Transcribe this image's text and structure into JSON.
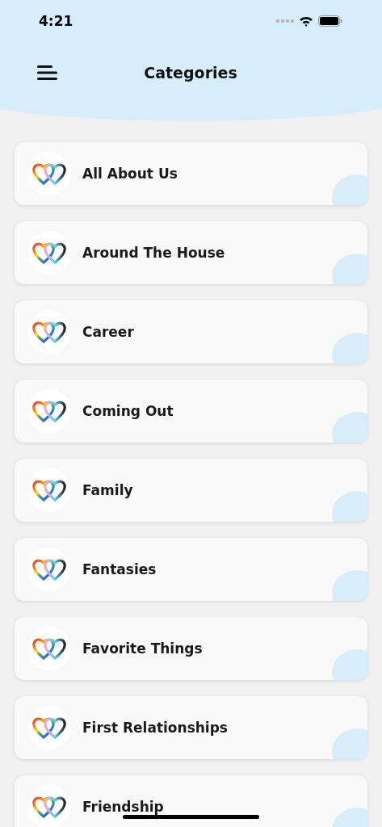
{
  "status_bar": {
    "time": "4:21"
  },
  "header": {
    "title": "Categories"
  },
  "categories": [
    {
      "label": "All About Us"
    },
    {
      "label": "Around The House"
    },
    {
      "label": "Career"
    },
    {
      "label": "Coming Out"
    },
    {
      "label": "Family"
    },
    {
      "label": "Fantasies"
    },
    {
      "label": "Favorite Things"
    },
    {
      "label": "First Relationships"
    },
    {
      "label": "Friendship"
    }
  ]
}
